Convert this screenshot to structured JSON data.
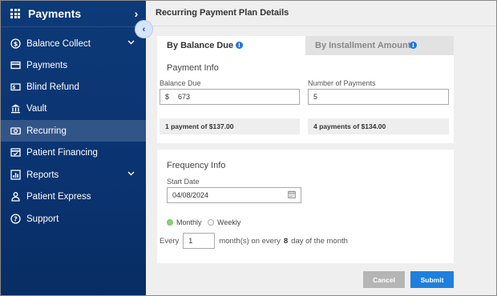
{
  "sidebar": {
    "title": "Payments",
    "header_chevron": "›",
    "collapse_icon": "‹",
    "items": [
      {
        "label": "Balance Collect",
        "icon": "dollar-circle-icon",
        "has_caret": true
      },
      {
        "label": "Payments",
        "icon": "credit-card-icon"
      },
      {
        "label": "Blind Refund",
        "icon": "cash-refund-icon"
      },
      {
        "label": "Vault",
        "icon": "bank-vault-icon"
      },
      {
        "label": "Recurring",
        "icon": "recurring-money-icon",
        "active": true
      },
      {
        "label": "Patient Financing",
        "icon": "financing-card-icon"
      },
      {
        "label": "Reports",
        "icon": "reports-chart-icon",
        "has_caret": true
      },
      {
        "label": "Patient Express",
        "icon": "person-icon"
      },
      {
        "label": "Support",
        "icon": "question-circle-icon"
      }
    ]
  },
  "main": {
    "page_title": "Recurring Payment Plan Details",
    "tabs": [
      {
        "label": "By Balance Due",
        "active": true
      },
      {
        "label": "By Installment Amount",
        "active": false
      }
    ],
    "info_icon": "i",
    "payment_info": {
      "title": "Payment Info",
      "balance_due_label": "Balance Due",
      "currency_symbol": "$",
      "balance_due_value": "673",
      "num_payments_label": "Number of Payments",
      "num_payments_value": "5",
      "summary_left": "1 payment of $137.00",
      "summary_right": "4 payments of $134.00"
    },
    "frequency_info": {
      "title": "Frequency Info",
      "start_date_label": "Start Date",
      "start_date_value": "04/08/2024",
      "options": [
        {
          "label": "Monthly",
          "selected": true
        },
        {
          "label": "Weekly",
          "selected": false
        }
      ],
      "every_label": "Every",
      "every_value": "1",
      "month_text_before": "month(s) on every",
      "day_number": "8",
      "month_text_after": "day of the month"
    },
    "buttons": {
      "cancel": "Cancel",
      "submit": "Submit"
    }
  },
  "colors": {
    "sidebar_bg": "#0a3370",
    "accent": "#1f7fde",
    "radio_selected": "#8bd07a"
  }
}
